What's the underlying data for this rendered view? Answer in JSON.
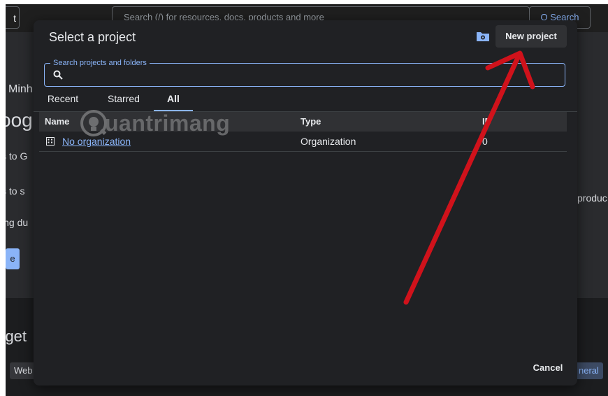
{
  "background": {
    "left_button_label": "t",
    "search_placeholder": "Search (/) for resources, docs, products and more",
    "search_button_label": "Q Search",
    "fragments": {
      "minh": "Minh",
      "google": "oog",
      "to_g": "s to G",
      "to_s": "s to s",
      "ding": "ing du",
      "produc": "produc",
      "get": "r get",
      "web": "Web",
      "general": "neral",
      "blue_btn": "e"
    }
  },
  "dialog": {
    "title": "Select a project",
    "new_project_label": "New project",
    "search": {
      "label": "Search projects and folders",
      "value": ""
    },
    "tabs": [
      {
        "label": "Recent",
        "active": false
      },
      {
        "label": "Starred",
        "active": false
      },
      {
        "label": "All",
        "active": true
      }
    ],
    "table": {
      "headers": {
        "name": "Name",
        "type": "Type",
        "id": "ID"
      },
      "rows": [
        {
          "name": "No organization",
          "type": "Organization",
          "id": "0"
        }
      ]
    },
    "cancel_label": "Cancel"
  },
  "watermark": {
    "text": "uantrimang"
  },
  "colors": {
    "accent": "#8ab4f8",
    "dialog_bg": "#202124",
    "annotation_arrow": "#d0121b"
  },
  "icons": {
    "search": "search-icon",
    "folder_settings": "folder-settings-icon",
    "organization": "organization-icon",
    "watermark_logo": "lightbulb-logo-icon"
  }
}
